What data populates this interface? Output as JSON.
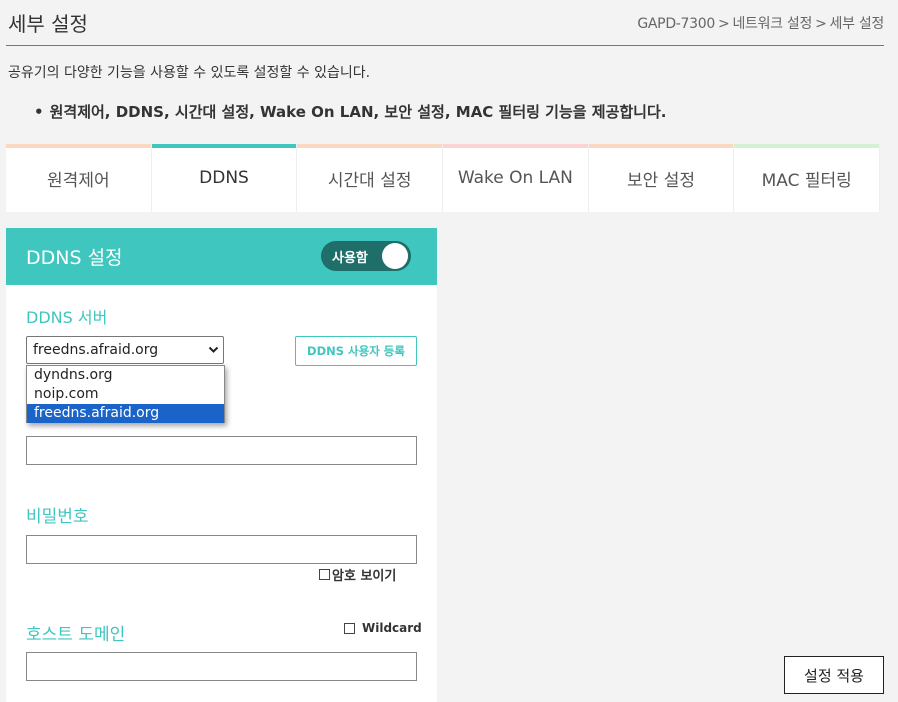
{
  "header": {
    "title": "세부 설정",
    "breadcrumb": [
      "GAPD-7300",
      "네트워크 설정",
      "세부 설정"
    ],
    "breadcrumb_sep": ">"
  },
  "description": "공유기의 다양한 기능을 사용할 수 있도록 설정할 수 있습니다.",
  "bullet": {
    "dot": "•",
    "text": "원격제어, DDNS, 시간대 설정, Wake On LAN, 보안 설정, MAC 필터링 기능을 제공합니다."
  },
  "tabs": [
    {
      "label": "원격제어",
      "color": "#f9d9c2",
      "active": false
    },
    {
      "label": "DDNS",
      "color": "#3fc6bf",
      "active": true
    },
    {
      "label": "시간대 설정",
      "color": "#f9d9c2",
      "active": false
    },
    {
      "label": "Wake On LAN",
      "color": "#fbd3d3",
      "active": false
    },
    {
      "label": "보안 설정",
      "color": "#f9d9c2",
      "active": false
    },
    {
      "label": "MAC 필터링",
      "color": "#d6f0d6",
      "active": false
    }
  ],
  "panel": {
    "title": "DDNS 설정",
    "toggle_label": "사용함",
    "accent": "#3fc6bf",
    "server_label": "DDNS 서버",
    "server_selected": "freedns.afraid.org",
    "server_options": [
      "dyndns.org",
      "noip.com",
      "freedns.afraid.org"
    ],
    "register_button": "DDNS 사용자 등록",
    "id_value": "",
    "password_label": "비밀번호",
    "password_value": "",
    "show_password_label": "암호 보이기",
    "host_label": "호스트 도메인",
    "wildcard_label": "Wildcard",
    "host_value": ""
  },
  "apply_button": "설정 적용"
}
